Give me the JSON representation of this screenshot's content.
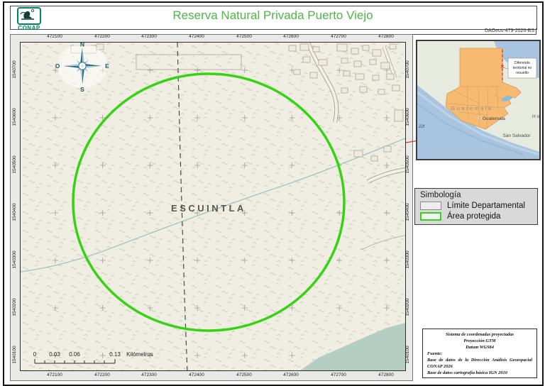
{
  "header": {
    "title": "Reserva Natural Privada Puerto Viejo",
    "doc_id": "DAGeos-479-2026-BS",
    "logo_text": "CONAP"
  },
  "map": {
    "x_labels": [
      "472100",
      "472200",
      "472300",
      "472400",
      "472500",
      "472600",
      "472700",
      "472800"
    ],
    "y_labels": [
      "1540700",
      "1540600",
      "1540500",
      "1540400",
      "1540300",
      "1540200",
      "1540100"
    ],
    "place_label": "ESCUINTLA",
    "compass": {
      "n": "N",
      "e": "E",
      "s": "S",
      "o": "O"
    },
    "scale_bar": {
      "labels": [
        "0",
        "0.03",
        "0.06",
        "0.13"
      ],
      "unit": "Kilómetros"
    }
  },
  "inset": {
    "country_label": "Guatemala",
    "capital_label": "Guatemala",
    "city_label": "San Salvador",
    "right_edge_label": "H o",
    "left_edge_label": "22t",
    "note_lines": [
      "Diferendo",
      "territorial no",
      "resuelto"
    ]
  },
  "legend": {
    "title": "Simbología",
    "items": [
      {
        "label": "Límite Departamental"
      },
      {
        "label": "Área protegida"
      }
    ]
  },
  "source_box": {
    "line1": "Sistema de coordenadas proyectadas",
    "line2": "Proyección GTM",
    "line3": "Datum WGS84",
    "line4": "Fuente:",
    "line5": "Base de datos de la Dirección Análisis Geoespacial",
    "line6": "CONAP 2026",
    "line7": "Base de datos cartografía básica IGN 2010"
  },
  "colors": {
    "accent_green": "#4db644",
    "protected_area_green": "#35d313",
    "water_fill": "#b4cec4",
    "guatemala_fill": "#f6ba73",
    "ocean_blue": "#a9c4de",
    "map_background": "#f0eee3"
  }
}
